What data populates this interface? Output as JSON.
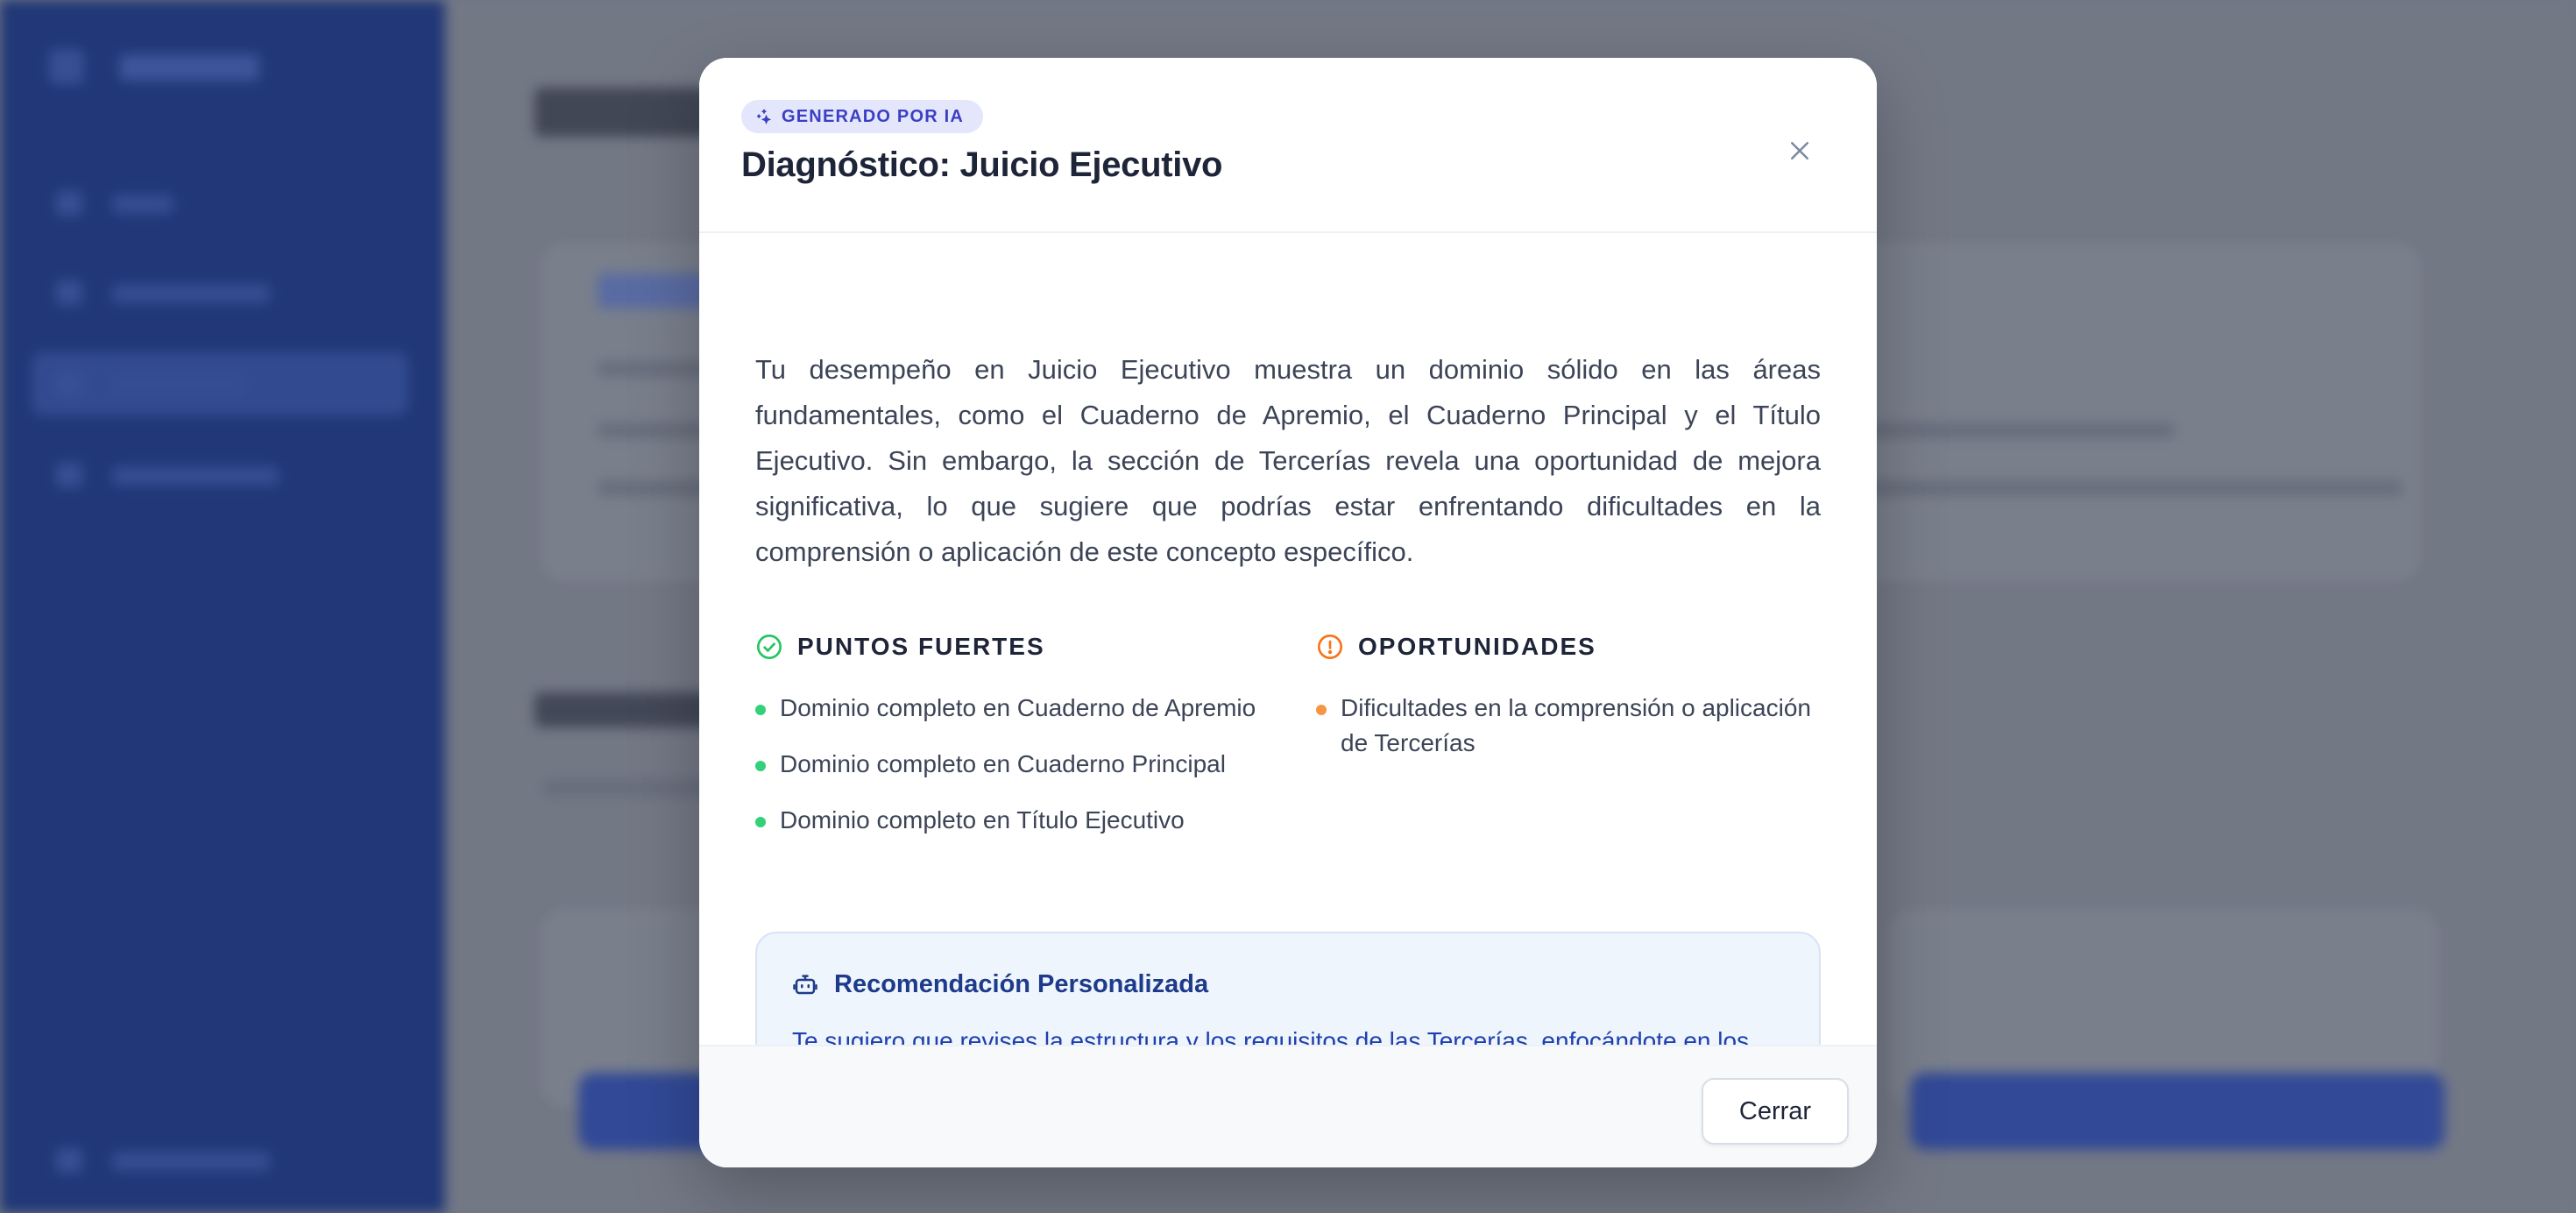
{
  "modal": {
    "badge": "GENERADO POR IA",
    "title": "Diagnóstico: Juicio Ejecutivo",
    "summary": "Tu desempeño en Juicio Ejecutivo muestra un dominio sólido en las áreas fundamentales, como el Cuaderno de Apremio, el Cuaderno Principal y el Título Ejecutivo. Sin embargo, la sección de Tercerías revela una oportunidad de mejora significativa, lo que sugiere que podrías estar enfrentando dificultades en la comprensión o aplicación de este concepto específico.",
    "strengths": {
      "heading": "PUNTOS FUERTES",
      "items": [
        "Dominio completo en Cuaderno de Apremio",
        "Dominio completo en Cuaderno Principal",
        "Dominio completo en Título Ejecutivo"
      ]
    },
    "opportunities": {
      "heading": "OPORTUNIDADES",
      "items": [
        "Dificultades en la comprensión o aplicación de Tercerías"
      ]
    },
    "recommendation": {
      "heading": "Recomendación Personalizada",
      "text": "Te sugiero que revises la estructura y los requisitos de las Tercerías, enfocándote en los aspectos procesales y la carga probatoria que se exige en esta etapa. Realiza ejercicios"
    },
    "close_button": "Cerrar"
  },
  "colors": {
    "badge_text": "#3b3fc4",
    "strength": "#22c55e",
    "opportunity": "#f97316",
    "recommendation": "#1e40af"
  },
  "icons": {
    "badge": "sparkles-icon",
    "close": "close-icon",
    "strengths": "check-circle-icon",
    "opportunities": "alert-circle-icon",
    "recommendation": "robot-icon"
  }
}
